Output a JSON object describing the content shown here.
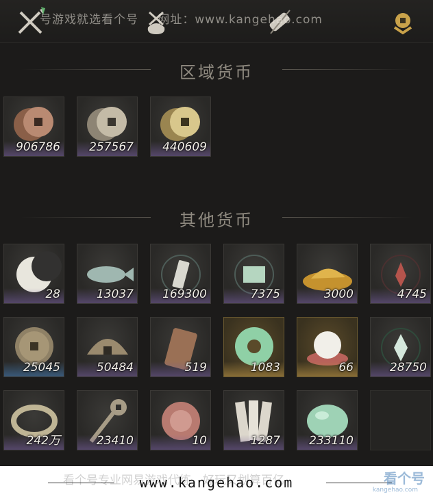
{
  "watermark_top": {
    "text": "号游戏就选看个号",
    "url": "网址：www.kangehao.com"
  },
  "tabs": [
    {
      "name": "crossed-swords-icon"
    },
    {
      "name": "bag-icon"
    },
    {
      "name": "scroll-icon"
    },
    {
      "name": "currency-coin-icon"
    }
  ],
  "sections": {
    "regional": {
      "title": "区域货币"
    },
    "other": {
      "title": "其他货币"
    }
  },
  "regional_items": [
    {
      "icon": "copper-coins-icon",
      "qty": "906786"
    },
    {
      "icon": "silver-coins-icon",
      "qty": "257567"
    },
    {
      "icon": "gold-coins-icon",
      "qty": "440609"
    }
  ],
  "other_items": [
    {
      "icon": "crescent-jade-icon",
      "qty": "28"
    },
    {
      "icon": "jade-fish-icon",
      "qty": "13037"
    },
    {
      "icon": "token-tablet-icon",
      "qty": "169300"
    },
    {
      "icon": "map-scroll-icon",
      "qty": "7375"
    },
    {
      "icon": "grain-pile-icon",
      "qty": "3000"
    },
    {
      "icon": "red-emblem-icon",
      "qty": "4745"
    },
    {
      "icon": "ancient-coin-icon",
      "qty": "25045"
    },
    {
      "icon": "half-coin-icon",
      "qty": "50484"
    },
    {
      "icon": "bronze-plaque-icon",
      "qty": "519"
    },
    {
      "icon": "jade-ring-icon",
      "qty": "1083"
    },
    {
      "icon": "pearl-icon",
      "qty": "66"
    },
    {
      "icon": "green-emblem-icon",
      "qty": "28750"
    },
    {
      "icon": "coin-string-icon",
      "qty": "242万"
    },
    {
      "icon": "key-coin-icon",
      "qty": "23410"
    },
    {
      "icon": "red-seal-icon",
      "qty": "10"
    },
    {
      "icon": "paper-notes-icon",
      "qty": "1287"
    },
    {
      "icon": "jade-stone-icon",
      "qty": "233110"
    },
    {
      "icon": "",
      "qty": ""
    }
  ],
  "footer": {
    "faint": "看个号专业网易游戏代练，好玩又划算百亿",
    "url": "www.kangehao.com",
    "logo": "看个号",
    "logo_sub": "kangehao.com"
  },
  "colors": {
    "background": "#1c1b1a",
    "tile": "#2f2e2b",
    "purple_glow": "#7a5fa0",
    "gold_tile": "#6b5a30"
  }
}
